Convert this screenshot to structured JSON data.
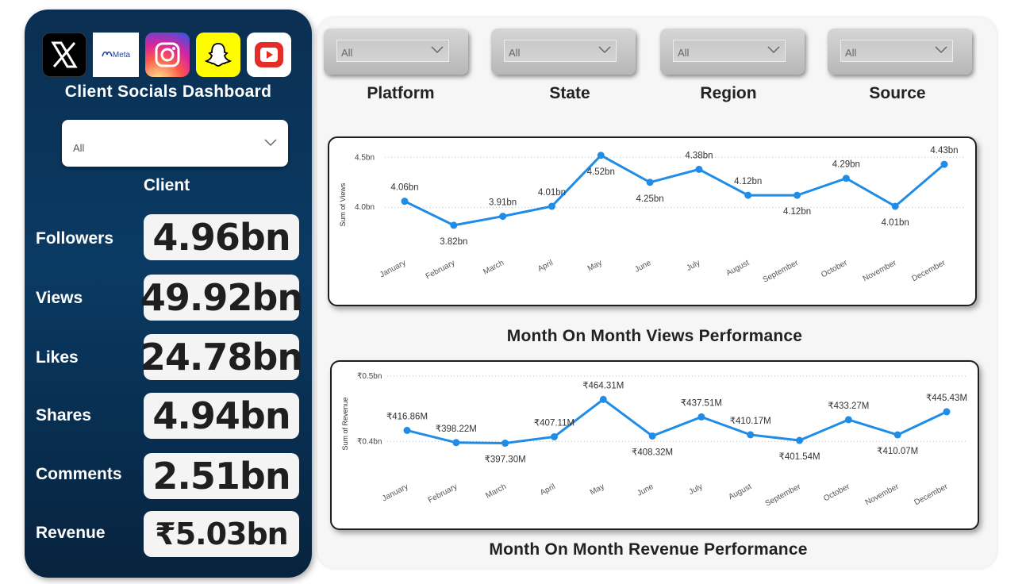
{
  "dashboard": {
    "title": "Client Socials Dashboard",
    "logos": [
      {
        "name": "x",
        "icon": "x-logo-icon",
        "label": ""
      },
      {
        "name": "meta",
        "icon": "meta-logo-icon",
        "label": "Meta"
      },
      {
        "name": "instagram",
        "icon": "instagram-logo-icon",
        "label": ""
      },
      {
        "name": "snapchat",
        "icon": "snapchat-logo-icon",
        "label": ""
      },
      {
        "name": "youtube",
        "icon": "youtube-logo-icon",
        "label": ""
      }
    ]
  },
  "client_filter": {
    "label": "Client",
    "value": "All"
  },
  "kpis": [
    {
      "label": "Followers",
      "value": "4.96bn"
    },
    {
      "label": "Views",
      "value": "49.92bn"
    },
    {
      "label": "Likes",
      "value": "24.78bn"
    },
    {
      "label": "Shares",
      "value": "4.94bn"
    },
    {
      "label": "Comments",
      "value": "2.51bn"
    },
    {
      "label": "Revenue",
      "value": "₹5.03bn"
    }
  ],
  "filters": [
    {
      "label": "Platform",
      "value": "All"
    },
    {
      "label": "State",
      "value": "All"
    },
    {
      "label": "Region",
      "value": "All"
    },
    {
      "label": "Source",
      "value": "All"
    }
  ],
  "colors": {
    "line": "#1f8ce8",
    "panel": "#0b2f52"
  },
  "chart_data": [
    {
      "type": "line",
      "title": "Month On Month Views Performance",
      "ylabel": "Sum of Views",
      "categories": [
        "January",
        "February",
        "March",
        "April",
        "May",
        "June",
        "July",
        "August",
        "September",
        "October",
        "November",
        "December"
      ],
      "values": [
        4.06,
        3.82,
        3.91,
        4.01,
        4.52,
        4.25,
        4.38,
        4.12,
        4.12,
        4.29,
        4.01,
        4.43
      ],
      "data_labels": [
        "4.06bn",
        "3.82bn",
        "3.91bn",
        "4.01bn",
        "4.52bn",
        "4.25bn",
        "4.38bn",
        "4.12bn",
        "4.12bn",
        "4.29bn",
        "4.01bn",
        "4.43bn"
      ],
      "yticks": [
        4.0,
        4.5
      ],
      "ytick_labels": [
        "4.0bn",
        "4.5bn"
      ],
      "ylim": [
        3.7,
        4.55
      ],
      "grid": true
    },
    {
      "type": "line",
      "title": "Month On Month Revenue Performance",
      "ylabel": "Sum of Revenue",
      "categories": [
        "January",
        "February",
        "March",
        "April",
        "May",
        "June",
        "July",
        "August",
        "September",
        "October",
        "November",
        "December"
      ],
      "values": [
        416.86,
        398.22,
        397.3,
        407.11,
        464.31,
        408.32,
        437.51,
        410.17,
        401.54,
        433.27,
        410.07,
        445.43
      ],
      "data_labels": [
        "₹416.86M",
        "₹398.22M",
        "₹397.30M",
        "₹407.11M",
        "₹464.31M",
        "₹408.32M",
        "₹437.51M",
        "₹410.17M",
        "₹401.54M",
        "₹433.27M",
        "₹410.07M",
        "₹445.43M"
      ],
      "yticks": [
        400,
        500
      ],
      "ytick_labels": [
        "₹0.4bn",
        "₹0.5bn"
      ],
      "ylim": [
        370,
        500
      ],
      "grid": true
    }
  ]
}
